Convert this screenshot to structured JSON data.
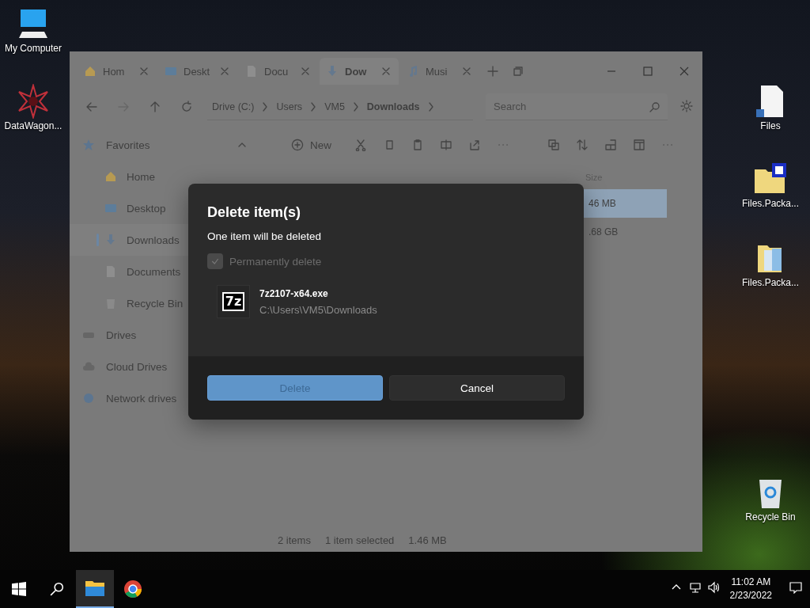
{
  "desktop_icons": [
    {
      "label": "My Computer",
      "kind": "computer"
    },
    {
      "label": "DataWagon...",
      "kind": "star"
    },
    {
      "label": "Files",
      "kind": "document"
    },
    {
      "label": "Files.Packa...",
      "kind": "zipfolder"
    },
    {
      "label": "Files.Packa...",
      "kind": "folder"
    },
    {
      "label": "Recycle Bin",
      "kind": "recycle"
    }
  ],
  "explorer": {
    "tabs": [
      {
        "label": "Hom",
        "kind": "home",
        "selected": false
      },
      {
        "label": "Deskt",
        "kind": "desktop",
        "selected": false
      },
      {
        "label": "Docu",
        "kind": "document",
        "selected": false
      },
      {
        "label": "Dow",
        "kind": "download",
        "selected": true
      },
      {
        "label": "Musi",
        "kind": "music",
        "selected": false
      }
    ],
    "nav": {
      "forward_disabled": true
    },
    "breadcrumb": [
      {
        "label": "Drive (C:)",
        "current": false
      },
      {
        "label": "Users",
        "current": false
      },
      {
        "label": "VM5",
        "current": false
      },
      {
        "label": "Downloads",
        "current": true
      }
    ],
    "search": {
      "placeholder": "Search"
    },
    "sidebar": {
      "items": [
        {
          "label": "Favorites",
          "kind": "star",
          "expanded": true,
          "children": [
            {
              "label": "Home",
              "kind": "home",
              "selected": false
            },
            {
              "label": "Desktop",
              "kind": "desktop",
              "selected": false
            },
            {
              "label": "Downloads",
              "kind": "download",
              "selected": true
            },
            {
              "label": "Documents",
              "kind": "document",
              "selected": false
            },
            {
              "label": "Recycle Bin",
              "kind": "recycle",
              "selected": false
            }
          ]
        },
        {
          "label": "Drives",
          "kind": "drive"
        },
        {
          "label": "Cloud Drives",
          "kind": "cloud"
        },
        {
          "label": "Network drives",
          "kind": "network"
        }
      ]
    },
    "toolbar": {
      "new_label": "New"
    },
    "file_list": {
      "columns": [
        "Size"
      ],
      "rows": [
        {
          "size": "46 MB",
          "selected": true
        },
        {
          "size": ".68 GB",
          "selected": false
        }
      ]
    },
    "status_bar": [
      "2 items",
      "1 item selected",
      "1.46 MB"
    ]
  },
  "dialog": {
    "title": "Delete item(s)",
    "message": "One item will be deleted",
    "permanently_delete": {
      "label": "Permanently delete",
      "checked": true,
      "disabled": true
    },
    "item": {
      "icon_label": "7z",
      "name": "7z2107-x64.exe",
      "path": "C:\\Users\\VM5\\Downloads"
    },
    "buttons": [
      {
        "label": "Delete",
        "kind": "primary",
        "disabled": true
      },
      {
        "label": "Cancel",
        "kind": "secondary",
        "disabled": false
      }
    ]
  },
  "taskbar": {
    "apps": [
      {
        "kind": "explorer",
        "active": true
      },
      {
        "kind": "browser",
        "active": false
      }
    ],
    "time": "11:02 AM",
    "date": "2/23/2022"
  }
}
